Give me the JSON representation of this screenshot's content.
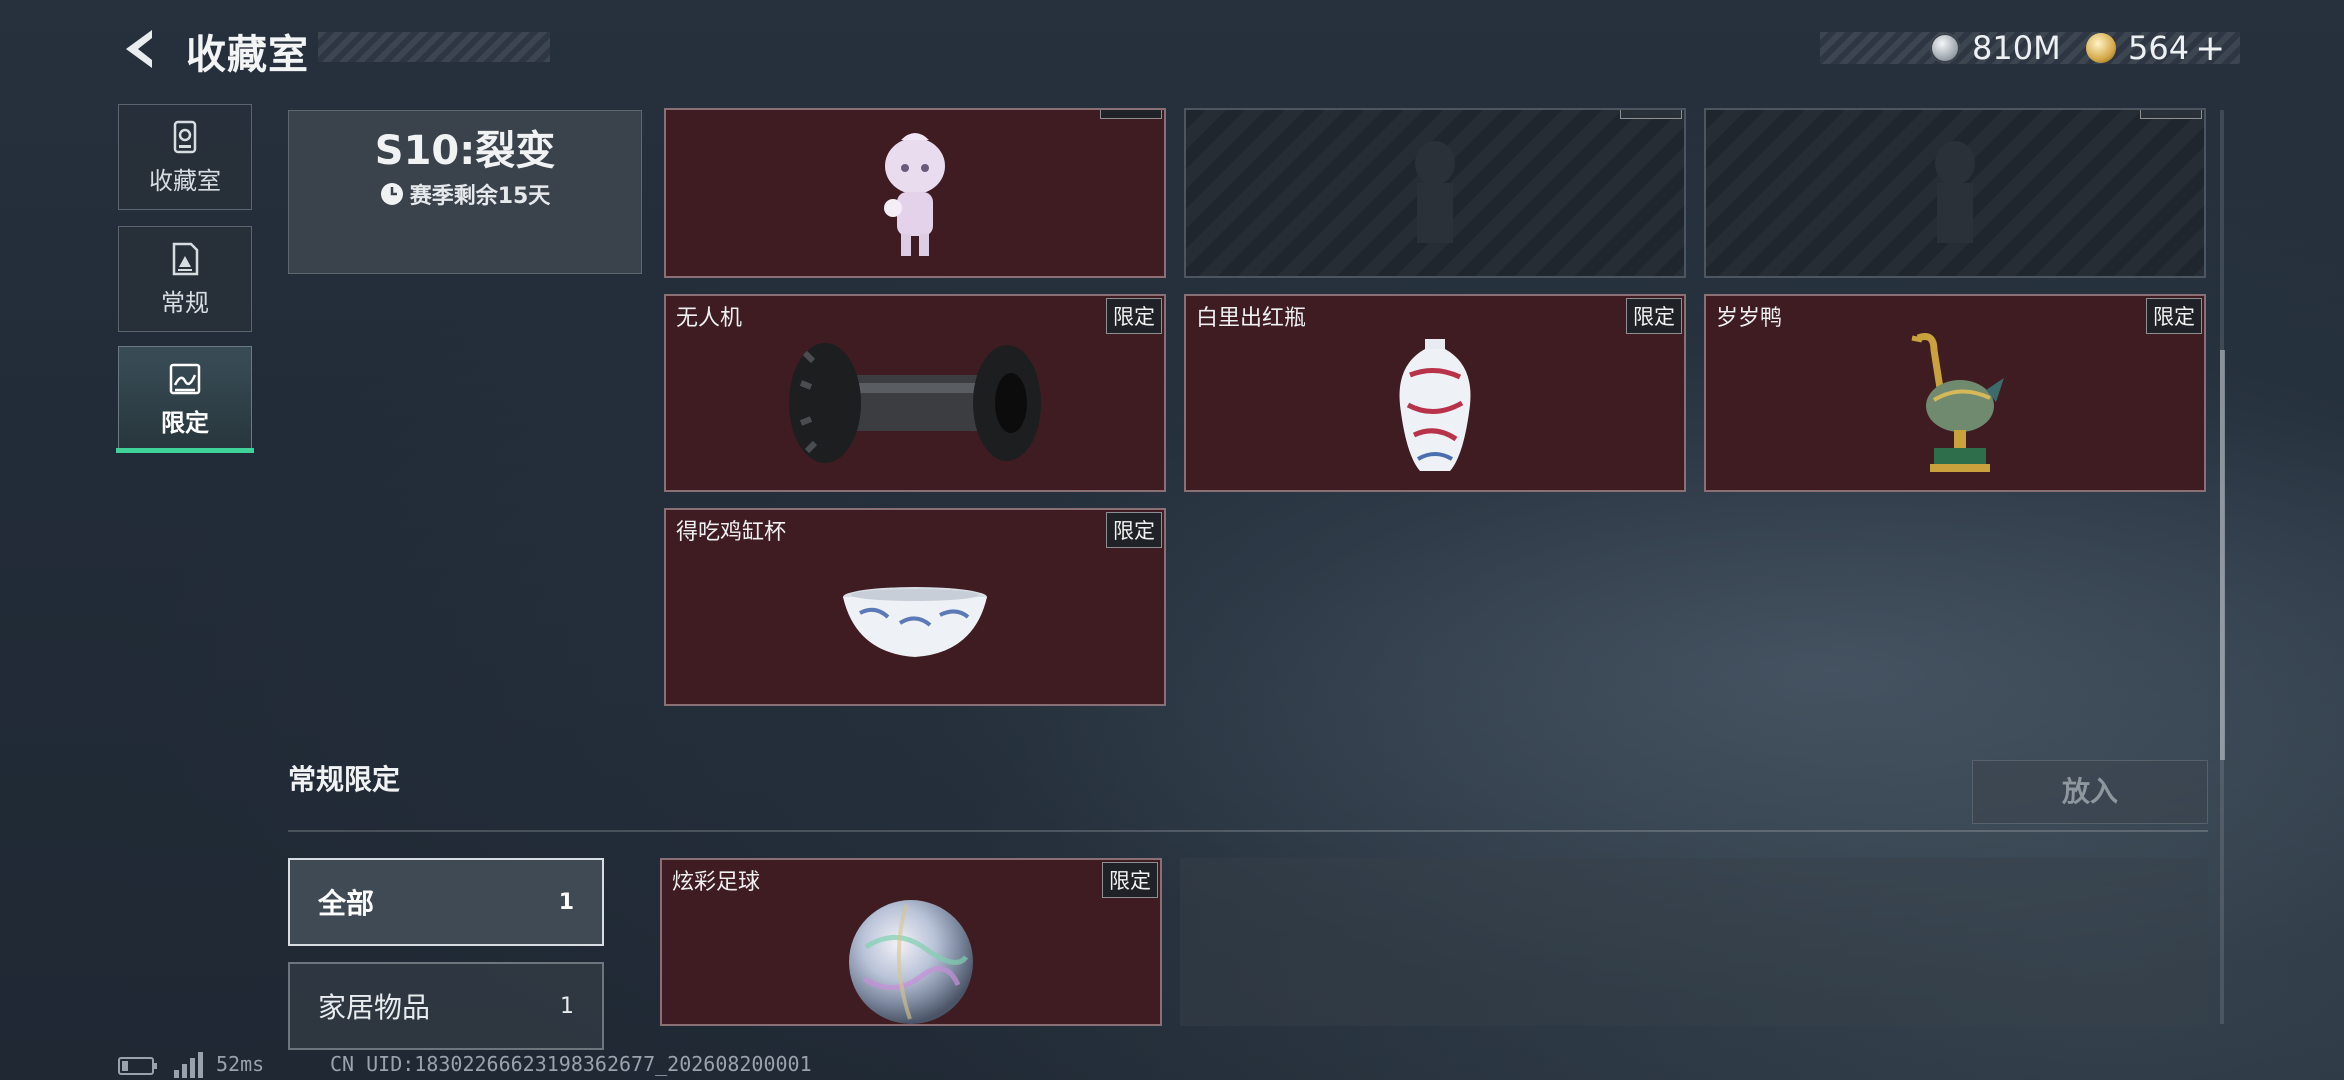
{
  "header": {
    "title": "收藏室",
    "currencies": [
      {
        "icon": "silver-coin-icon",
        "value": "810M"
      },
      {
        "icon": "gold-coin-icon",
        "value": "564"
      }
    ],
    "plus": "+"
  },
  "nav": [
    {
      "label": "收藏室",
      "icon": "collection-icon"
    },
    {
      "label": "常规",
      "icon": "document-icon"
    },
    {
      "label": "限定",
      "icon": "image-icon",
      "active": true
    }
  ],
  "season": {
    "title": "S10:裂变",
    "remaining": "赛季剩余15天"
  },
  "cards_top": [
    {
      "name": "",
      "art": "doll-figurine"
    },
    {
      "name": "",
      "art": "locked"
    },
    {
      "name": "",
      "art": "locked"
    }
  ],
  "cards": [
    {
      "name": "无人机",
      "tag": "限定",
      "art": "drone-roller"
    },
    {
      "name": "白里出红瓶",
      "tag": "限定",
      "art": "porcelain-vase"
    },
    {
      "name": "岁岁鸭",
      "tag": "限定",
      "art": "cloisonne-duck"
    },
    {
      "name": "得吃鸡缸杯",
      "tag": "限定",
      "art": "porcelain-cup"
    }
  ],
  "section": {
    "title": "常规限定",
    "put_button": "放入",
    "filters": [
      {
        "label": "全部",
        "count": "1",
        "selected": true
      },
      {
        "label": "家居物品",
        "count": "1"
      }
    ],
    "items": [
      {
        "name": "炫彩足球",
        "tag": "限定",
        "art": "iridescent-ball"
      }
    ]
  },
  "statusbar": {
    "ping": "52ms",
    "uid": "CN UID:18302266623198362677_202608200001"
  },
  "colors": {
    "card_bg": "#3f1c22",
    "accent": "#3fd39a"
  }
}
